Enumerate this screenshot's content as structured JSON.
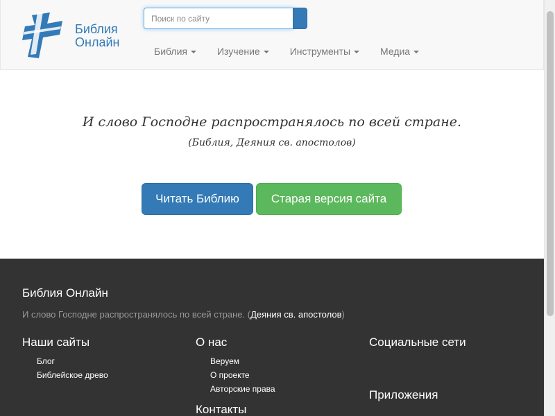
{
  "header": {
    "brand_line1": "Библия",
    "brand_line2": "Онлайн",
    "search_placeholder": "Поиск по сайту",
    "menu": [
      {
        "label": "Библия"
      },
      {
        "label": "Изучение"
      },
      {
        "label": "Инструменты"
      },
      {
        "label": "Медиа"
      }
    ]
  },
  "main": {
    "quote_text": "И слово Господне распространялось по всей стране.",
    "quote_source": "(Библия, Деяния св. апостолов)",
    "read_button": "Читать Библию",
    "old_site_button": "Старая версия сайта"
  },
  "footer": {
    "title": "Библия Онлайн",
    "quote_text": "И слово Господне распространялось по всей стране. (",
    "quote_link": "Деяния св. апостолов",
    "quote_close": ")",
    "our_sites": {
      "heading": "Наши сайты",
      "items": [
        "Блог",
        "Библейское древо"
      ]
    },
    "about": {
      "heading": "О нас",
      "items": [
        "Веруем",
        "О проекте",
        "Авторские права"
      ]
    },
    "contacts_heading": "Контакты",
    "social_heading": "Социальные сети",
    "apps_heading": "Приложения"
  },
  "colors": {
    "primary": "#337ab7",
    "success": "#5cb85c",
    "footer_bg": "#333333",
    "navbar_bg": "#f8f8f8"
  },
  "icons": {
    "logo": "cross-logo-icon",
    "menu_dropdown": "caret-down-icon"
  }
}
